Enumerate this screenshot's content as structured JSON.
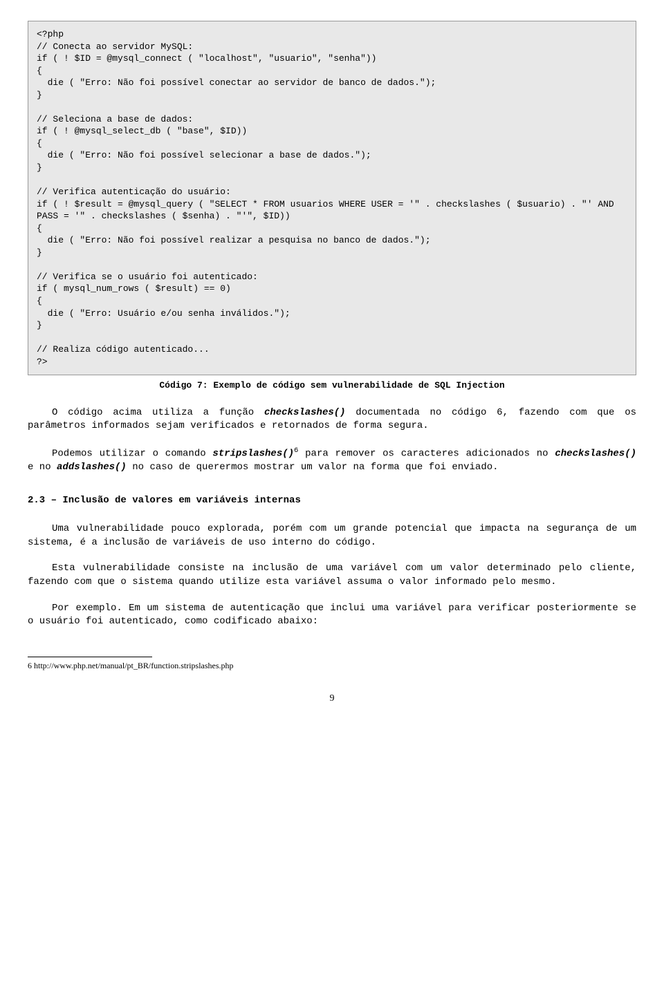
{
  "code": "<?php\n// Conecta ao servidor MySQL:\nif ( ! $ID = @mysql_connect ( \"localhost\", \"usuario\", \"senha\"))\n{\n  die ( \"Erro: Não foi possível conectar ao servidor de banco de dados.\");\n}\n\n// Seleciona a base de dados:\nif ( ! @mysql_select_db ( \"base\", $ID))\n{\n  die ( \"Erro: Não foi possível selecionar a base de dados.\");\n}\n\n// Verifica autenticação do usuário:\nif ( ! $result = @mysql_query ( \"SELECT * FROM usuarios WHERE USER = '\" . checkslashes ( $usuario) . \"' AND PASS = '\" . checkslashes ( $senha) . \"'\", $ID))\n{\n  die ( \"Erro: Não foi possível realizar a pesquisa no banco de dados.\");\n}\n\n// Verifica se o usuário foi autenticado:\nif ( mysql_num_rows ( $result) == 0)\n{\n  die ( \"Erro: Usuário e/ou senha inválidos.\");\n}\n\n// Realiza código autenticado...\n?>",
  "caption": "Código 7: Exemplo de código sem vulnerabilidade de SQL Injection",
  "para1_a": "O código acima utiliza a função ",
  "para1_b": "checkslashes()",
  "para1_c": " documentada no código 6, fazendo com que os parâmetros informados sejam verificados e retornados de forma segura.",
  "para2_a": "Podemos utilizar o comando ",
  "para2_b": "stripslashes()",
  "para2_sup": "6",
  "para2_c": " para remover os caracteres adicionados no ",
  "para2_d": "checkslashes()",
  "para2_e": " e no ",
  "para2_f": "addslashes()",
  "para2_g": " no caso de querermos mostrar um valor na forma que foi enviado.",
  "section_title": "2.3 – Inclusão de valores em variáveis internas",
  "para3": "Uma vulnerabilidade pouco explorada, porém com um grande potencial que impacta na segurança de um sistema, é a inclusão de variáveis de uso interno do código.",
  "para4": "Esta vulnerabilidade consiste na inclusão de uma variável com um valor determinado pelo cliente, fazendo com que o sistema quando utilize esta variável assuma o valor informado pelo mesmo.",
  "para5": "Por exemplo. Em um sistema de autenticação que inclui uma variável para verificar posteriormente se o usuário foi autenticado, como codificado abaixo:",
  "footnote": "6 http://www.php.net/manual/pt_BR/function.stripslashes.php",
  "pagenum": "9"
}
